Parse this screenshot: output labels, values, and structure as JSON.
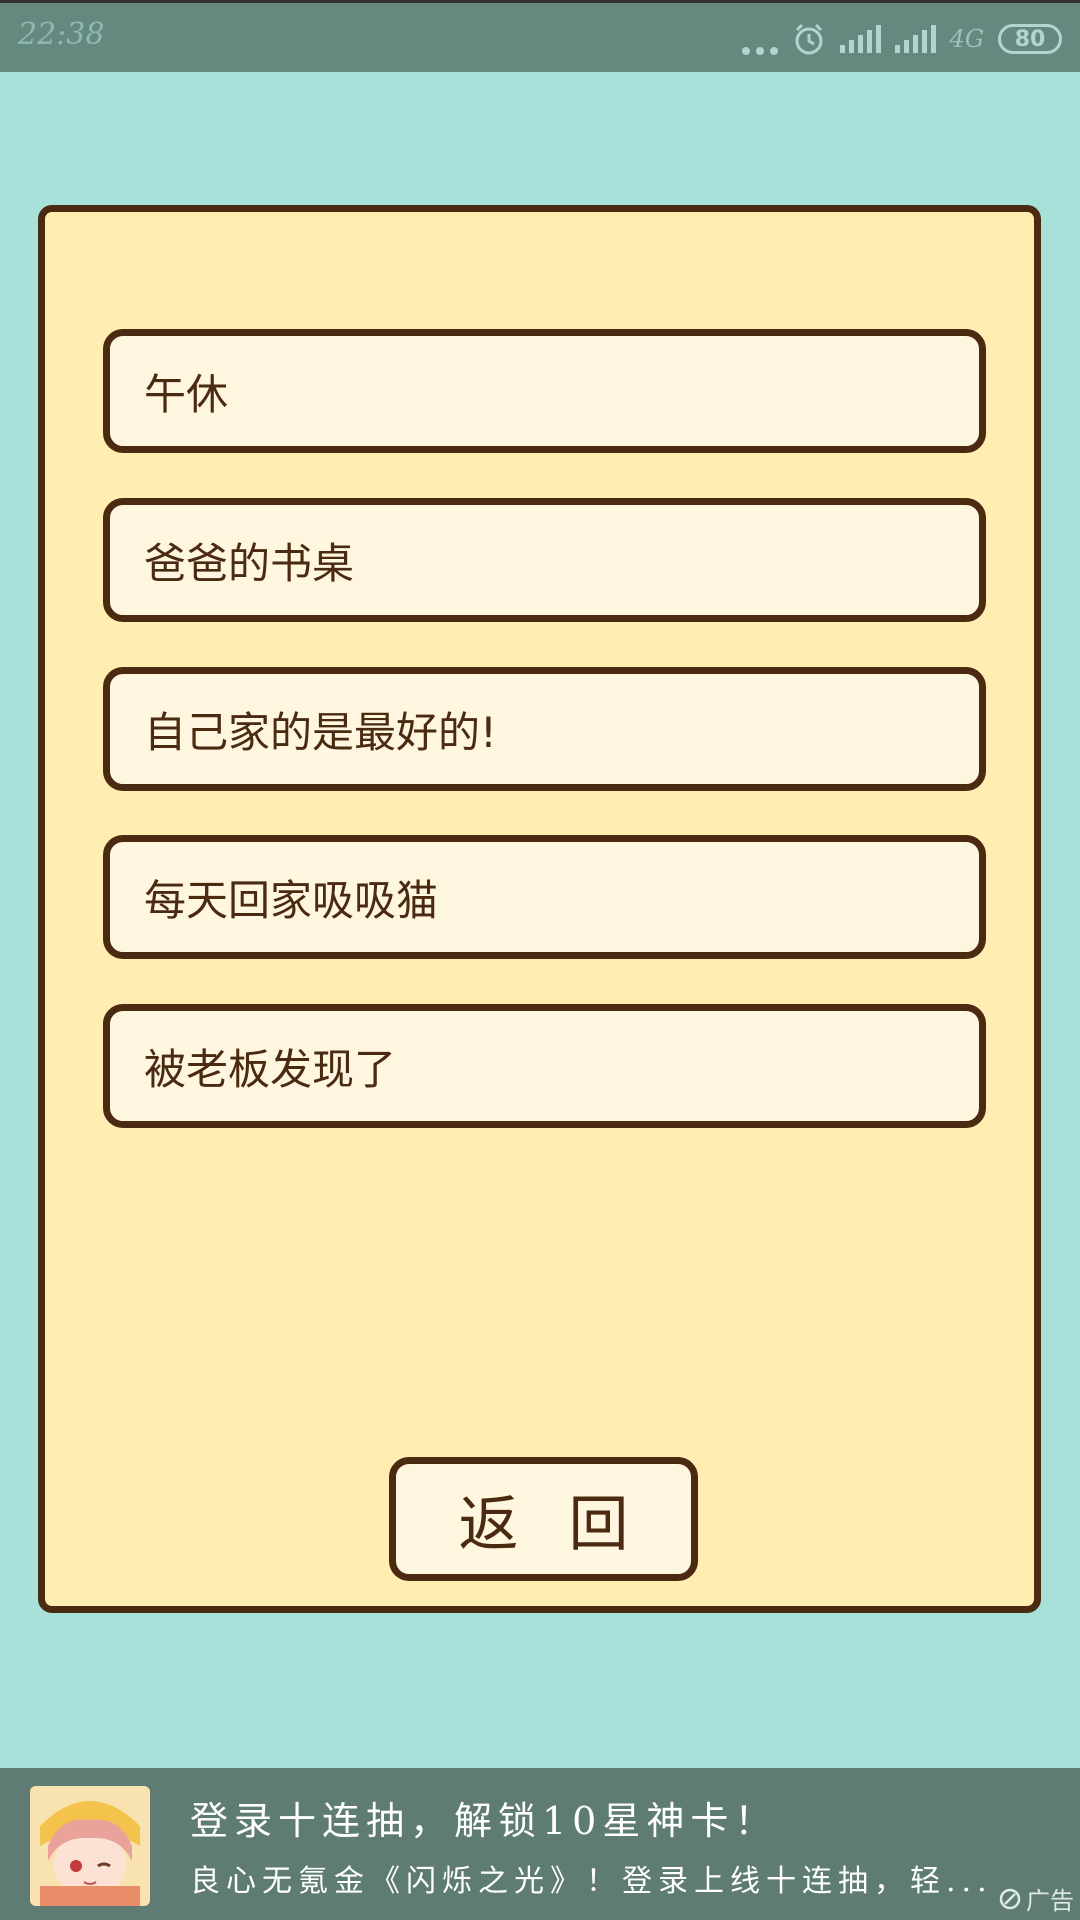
{
  "status_bar": {
    "time": "22:38",
    "network": "4G",
    "battery": "80",
    "icons": [
      "more-dots-icon",
      "alarm-icon",
      "signal-icon",
      "signal-icon",
      "battery-icon"
    ]
  },
  "options": [
    {
      "label": "午休"
    },
    {
      "label": "爸爸的书桌"
    },
    {
      "label": "自己家的是最好的!"
    },
    {
      "label": "每天回家吸吸猫"
    },
    {
      "label": "被老板发现了"
    }
  ],
  "back_button": {
    "label": "返回"
  },
  "ad": {
    "title": "登录十连抽，解锁10星神卡！",
    "description": "良心无氪金《闪烁之光》！登录上线十连抽，轻...",
    "tag": "广告"
  },
  "colors": {
    "background": "#a8e0da",
    "panel": "#ffedb2",
    "button": "#fff6e0",
    "border": "#4a2a10",
    "status_bar": "#66897f",
    "ad_banner": "#5e7b74"
  }
}
